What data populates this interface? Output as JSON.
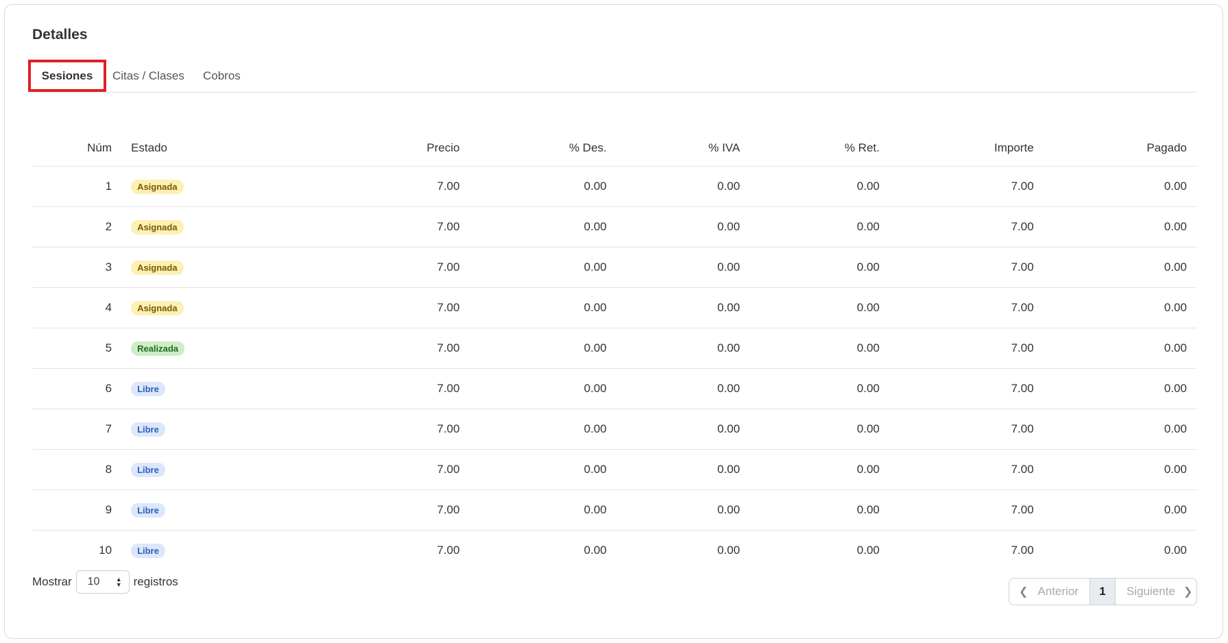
{
  "card": {
    "title": "Detalles"
  },
  "tabs": [
    {
      "label": "Sesiones",
      "active": true
    },
    {
      "label": "Citas / Clases",
      "active": false
    },
    {
      "label": "Cobros",
      "active": false
    }
  ],
  "table": {
    "headers": {
      "num": "Núm",
      "estado": "Estado",
      "precio": "Precio",
      "des": "% Des.",
      "iva": "% IVA",
      "ret": "% Ret.",
      "importe": "Importe",
      "pagado": "Pagado"
    },
    "rows": [
      {
        "num": "1",
        "estado": "Asignada",
        "precio": "7.00",
        "des": "0.00",
        "iva": "0.00",
        "ret": "0.00",
        "importe": "7.00",
        "pagado": "0.00"
      },
      {
        "num": "2",
        "estado": "Asignada",
        "precio": "7.00",
        "des": "0.00",
        "iva": "0.00",
        "ret": "0.00",
        "importe": "7.00",
        "pagado": "0.00"
      },
      {
        "num": "3",
        "estado": "Asignada",
        "precio": "7.00",
        "des": "0.00",
        "iva": "0.00",
        "ret": "0.00",
        "importe": "7.00",
        "pagado": "0.00"
      },
      {
        "num": "4",
        "estado": "Asignada",
        "precio": "7.00",
        "des": "0.00",
        "iva": "0.00",
        "ret": "0.00",
        "importe": "7.00",
        "pagado": "0.00"
      },
      {
        "num": "5",
        "estado": "Realizada",
        "precio": "7.00",
        "des": "0.00",
        "iva": "0.00",
        "ret": "0.00",
        "importe": "7.00",
        "pagado": "0.00"
      },
      {
        "num": "6",
        "estado": "Libre",
        "precio": "7.00",
        "des": "0.00",
        "iva": "0.00",
        "ret": "0.00",
        "importe": "7.00",
        "pagado": "0.00"
      },
      {
        "num": "7",
        "estado": "Libre",
        "precio": "7.00",
        "des": "0.00",
        "iva": "0.00",
        "ret": "0.00",
        "importe": "7.00",
        "pagado": "0.00"
      },
      {
        "num": "8",
        "estado": "Libre",
        "precio": "7.00",
        "des": "0.00",
        "iva": "0.00",
        "ret": "0.00",
        "importe": "7.00",
        "pagado": "0.00"
      },
      {
        "num": "9",
        "estado": "Libre",
        "precio": "7.00",
        "des": "0.00",
        "iva": "0.00",
        "ret": "0.00",
        "importe": "7.00",
        "pagado": "0.00"
      },
      {
        "num": "10",
        "estado": "Libre",
        "precio": "7.00",
        "des": "0.00",
        "iva": "0.00",
        "ret": "0.00",
        "importe": "7.00",
        "pagado": "0.00"
      }
    ]
  },
  "footer": {
    "show_label": "Mostrar",
    "page_size": "10",
    "records_label": "registros"
  },
  "pagination": {
    "prev_label": "Anterior",
    "current_page": "1",
    "next_label": "Siguiente"
  },
  "colors": {
    "active_tab_outline": "#e01f26",
    "badge_asignada_bg": "#fdf0b3",
    "badge_realizada_bg": "#cdeec8",
    "badge_libre_bg": "#dde7fb"
  }
}
